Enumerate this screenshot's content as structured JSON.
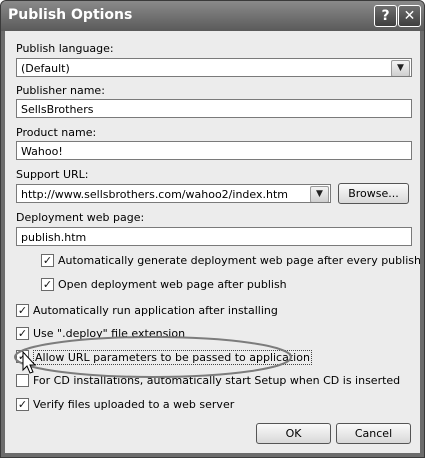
{
  "window": {
    "title": "Publish Options",
    "help_glyph": "?",
    "close_glyph": "✕"
  },
  "publish_language": {
    "label": "Publish language:",
    "value": "(Default)"
  },
  "publisher_name": {
    "label": "Publisher name:",
    "value": "SellsBrothers"
  },
  "product_name": {
    "label": "Product name:",
    "value": "Wahoo!"
  },
  "support_url": {
    "label": "Support URL:",
    "value": "http://www.sellsbrothers.com/wahoo2/index.htm",
    "browse_label": "Browse..."
  },
  "deployment_page": {
    "label": "Deployment web page:",
    "value": "publish.htm"
  },
  "checkboxes": [
    {
      "label": "Automatically generate deployment web page after every publish",
      "checked": true
    },
    {
      "label": "Open deployment web page after publish",
      "checked": true
    },
    {
      "label": "Automatically run application after installing",
      "checked": true
    },
    {
      "label": "Use \".deploy\" file extension",
      "checked": true
    },
    {
      "label": "Allow URL parameters to be passed to application",
      "checked": true
    },
    {
      "label": "For CD installations, automatically start Setup when CD is inserted",
      "checked": false
    },
    {
      "label": "Verify files uploaded to a web server",
      "checked": true
    }
  ],
  "buttons": {
    "ok": "OK",
    "cancel": "Cancel"
  },
  "glyphs": {
    "check": "✓",
    "dropdown": "▼"
  }
}
